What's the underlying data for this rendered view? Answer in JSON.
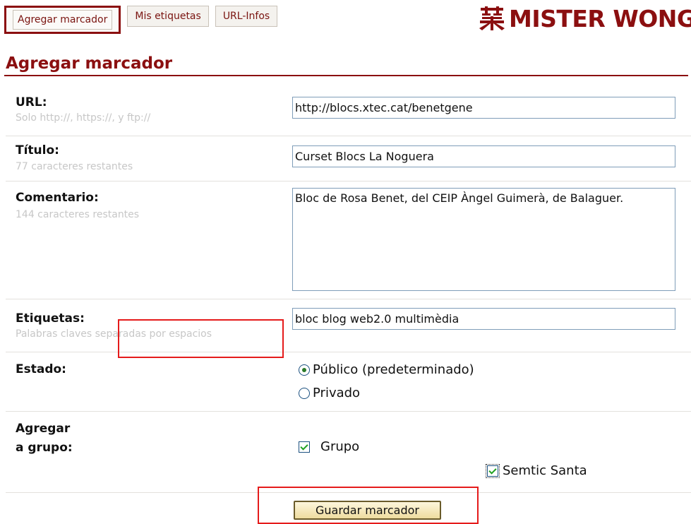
{
  "tabs": [
    {
      "label": "Agregar marcador",
      "active": true
    },
    {
      "label": "Mis etiquetas",
      "active": false
    },
    {
      "label": "URL-Infos",
      "active": false
    }
  ],
  "logo": {
    "text": "MISTER WONG",
    "color": "#8b0f10"
  },
  "page_title": "Agregar marcador",
  "form": {
    "url": {
      "label": "URL:",
      "hint": "Solo http://, https://, y ftp://",
      "value": "http://blocs.xtec.cat/benetgene"
    },
    "titulo": {
      "label": "Título:",
      "hint": "77 caracteres restantes",
      "value": "Curset Blocs La Noguera"
    },
    "comentario": {
      "label": "Comentario:",
      "hint": "144 caracteres restantes",
      "value": "Bloc de Rosa Benet, del CEIP Àngel Guimerà, de Balaguer."
    },
    "etiquetas": {
      "label": "Etiquetas:",
      "hint": "Palabras claves separadas por espacios",
      "value": "bloc blog web2.0 multimèdia"
    },
    "estado": {
      "label": "Estado:",
      "options": [
        {
          "label": "Público (predeterminado)",
          "selected": true
        },
        {
          "label": "Privado",
          "selected": false
        }
      ]
    },
    "grupo": {
      "label_line1": "Agregar",
      "label_line2": "a grupo:",
      "checkbox_label": "Grupo",
      "checkbox_checked": true,
      "group_name": "Semtic Santa",
      "group_checked": true
    },
    "save_label": "Guardar marcador"
  },
  "colors": {
    "accent": "#8b0f10",
    "highlight": "#e51b1b",
    "hint": "#c7c7c7",
    "input_border": "#7f9db9"
  }
}
